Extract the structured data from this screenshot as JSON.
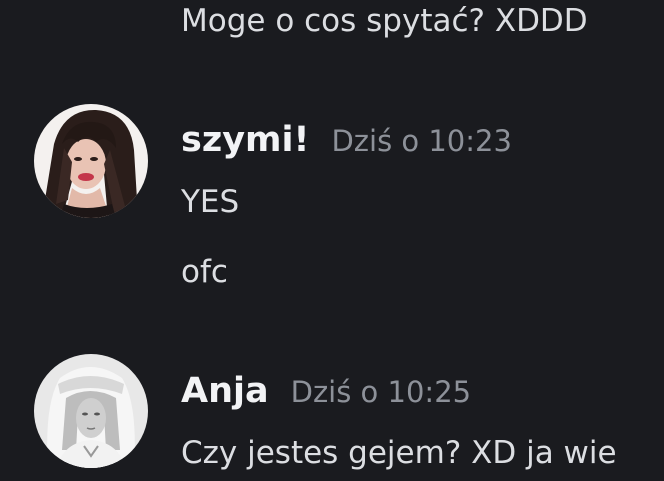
{
  "messages": {
    "prev_line": "Moge o cos spytać? XDDD",
    "group_szymi": {
      "username": "szymi!",
      "timestamp": "Dziś o 10:23",
      "lines": [
        "YES",
        "ofc"
      ],
      "avatar_icon": "user-avatar-dark-hair"
    },
    "group_anja": {
      "username": "Anja",
      "timestamp": "Dziś o 10:25",
      "lines": [
        "Czy jestes gejem? XD ja wie"
      ],
      "avatar_icon": "user-avatar-white-hood"
    }
  },
  "colors": {
    "background": "#1a1b1f",
    "text": "#dcdee2",
    "username": "#f2f3f5",
    "timestamp": "#8d9199"
  }
}
